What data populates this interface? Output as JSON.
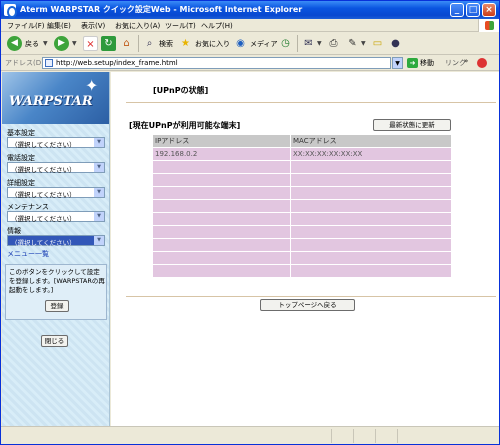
{
  "window": {
    "title": "Aterm WARPSTAR クイック設定Web - Microsoft Internet Explorer",
    "min_glyph": "_",
    "max_glyph": "□",
    "close_glyph": "×"
  },
  "menu": [
    "ファイル(F)",
    "編集(E)",
    "表示(V)",
    "お気に入り(A)",
    "ツール(T)",
    "ヘルプ(H)"
  ],
  "toolbar": {
    "back_label": "戻る",
    "search_label": "検索",
    "favorites_label": "お気に入り",
    "media_label": "メディア"
  },
  "address": {
    "label": "アドレス(D)",
    "url": "http://web.setup/index_frame.html",
    "go_label": "移動",
    "links_label": "リンク"
  },
  "sidebar": {
    "logo_text": "WARPSTAR",
    "groups": [
      {
        "label": "基本設定",
        "value": "（選択してください）"
      },
      {
        "label": "電話設定",
        "value": "（選択してください）"
      },
      {
        "label": "詳細設定",
        "value": "（選択してください）"
      },
      {
        "label": "メンテナンス",
        "value": "（選択してください）"
      },
      {
        "label": "情報",
        "value": "（選択してください）"
      }
    ],
    "menu_list_link": "メニュー一覧",
    "notice_text": "このボタンをクリックして設定を登録します。[WARPSTARの再起動をします。]",
    "register_button": "登録",
    "close_button": "閉じる"
  },
  "main": {
    "page_title": "[UPnPの状態]",
    "section_title": "[現在UPnPが利用可能な端末]",
    "refresh_button": "最新状態に更新",
    "table": {
      "headers": [
        "IPアドレス",
        "MACアドレス"
      ],
      "rows": [
        [
          "192.168.0.2",
          "XX:XX:XX:XX:XX:XX"
        ],
        [
          "",
          ""
        ],
        [
          "",
          ""
        ],
        [
          "",
          ""
        ],
        [
          "",
          ""
        ],
        [
          "",
          ""
        ],
        [
          "",
          ""
        ],
        [
          "",
          ""
        ],
        [
          "",
          ""
        ],
        [
          "",
          ""
        ]
      ]
    },
    "top_page_button": "トップページへ戻る"
  },
  "colors": {
    "titlebar": "#0a55e0",
    "table_header": "#c8c8c8",
    "table_cell": "#e2c6e0",
    "sidebar_bg": "#cde4f2",
    "link": "#1a3fb4"
  }
}
